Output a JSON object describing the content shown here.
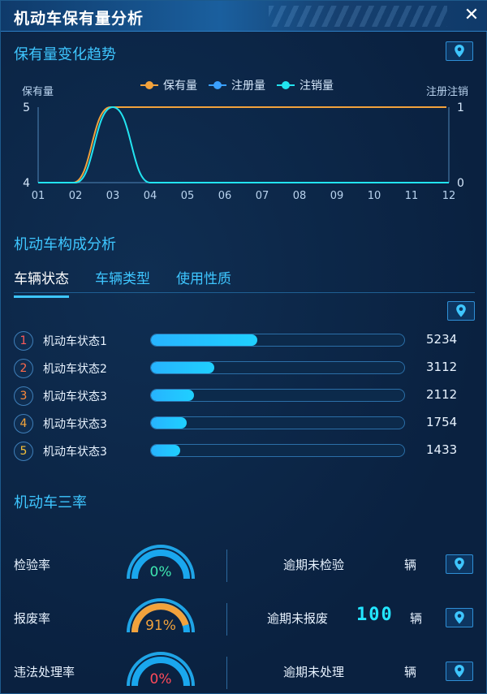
{
  "window": {
    "title": "机动车保有量分析",
    "close_icon": "close-icon"
  },
  "trend": {
    "section_title": "保有量变化趋势",
    "left_axis_label": "保有量",
    "right_axis_label": "注册注销",
    "legend": [
      {
        "name": "保有量",
        "color": "#f2a23c"
      },
      {
        "name": "注册量",
        "color": "#3aa0ff"
      },
      {
        "name": "注销量",
        "color": "#22e4f0"
      }
    ]
  },
  "chart_data": {
    "type": "line",
    "x": [
      "01",
      "02",
      "03",
      "04",
      "05",
      "06",
      "07",
      "08",
      "09",
      "10",
      "11",
      "12"
    ],
    "left_ylim": [
      4,
      5
    ],
    "right_ylim": [
      0,
      1
    ],
    "left_ticks": [
      "5",
      "4"
    ],
    "right_ticks": [
      "1",
      "0"
    ],
    "series": [
      {
        "name": "保有量",
        "axis": "left",
        "values": [
          4,
          4,
          5,
          5,
          5,
          5,
          5,
          5,
          5,
          5,
          5,
          5
        ]
      },
      {
        "name": "注册量",
        "axis": "right",
        "values": [
          0,
          0,
          1,
          0,
          0,
          0,
          0,
          0,
          0,
          0,
          0,
          0
        ]
      },
      {
        "name": "注销量",
        "axis": "right",
        "values": [
          0,
          0,
          1,
          0,
          0,
          0,
          0,
          0,
          0,
          0,
          0,
          0
        ]
      }
    ]
  },
  "composition": {
    "section_title": "机动车构成分析",
    "tabs": [
      "车辆状态",
      "车辆类型",
      "使用性质"
    ],
    "active_tab": 0,
    "max_value": 12500,
    "items": [
      {
        "rank": "1",
        "label": "机动车状态1",
        "value": "5234",
        "num": 5234,
        "rank_color": "#ff5a5a"
      },
      {
        "rank": "2",
        "label": "机动车状态2",
        "value": "3112",
        "num": 3112,
        "rank_color": "#ff6a4a"
      },
      {
        "rank": "3",
        "label": "机动车状态3",
        "value": "2112",
        "num": 2112,
        "rank_color": "#ff8a3a"
      },
      {
        "rank": "4",
        "label": "机动车状态3",
        "value": "1754",
        "num": 1754,
        "rank_color": "#f5a53a"
      },
      {
        "rank": "5",
        "label": "机动车状态3",
        "value": "1433",
        "num": 1433,
        "rank_color": "#f5c03a"
      }
    ]
  },
  "rates": {
    "section_title": "机动车三率",
    "items": [
      {
        "label": "检验率",
        "percent_text": "0%",
        "percent": 0,
        "text_color": "#3ee6b0",
        "right_label": "逾期未检验",
        "count": "",
        "unit": "辆"
      },
      {
        "label": "报废率",
        "percent_text": "91%",
        "percent": 91,
        "text_color": "#f2a23c",
        "right_label": "逾期未报废",
        "count": "100",
        "unit": "辆"
      },
      {
        "label": "违法处理率",
        "percent_text": "0%",
        "percent": 0,
        "text_color": "#ff4a5a",
        "right_label": "逾期未处理",
        "count": "",
        "unit": "辆"
      }
    ]
  }
}
